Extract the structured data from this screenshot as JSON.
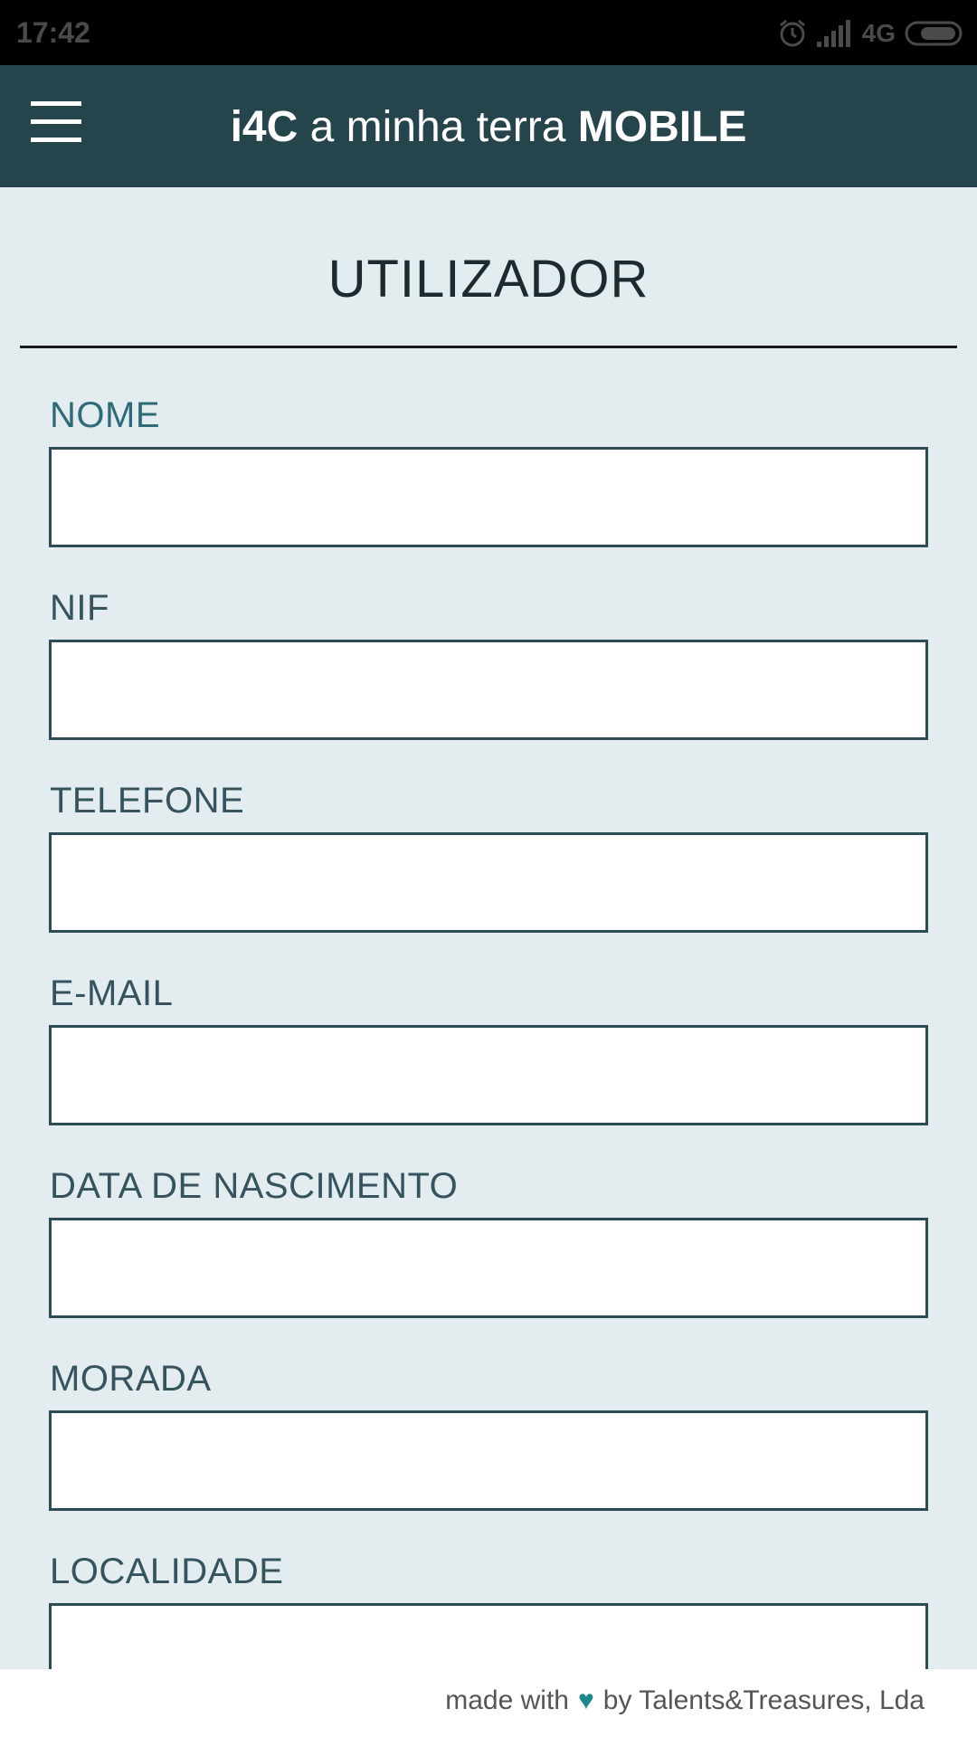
{
  "status_bar": {
    "time": "17:42",
    "network": "4G",
    "icons": [
      "alarm-icon",
      "signal-icon",
      "battery-icon"
    ]
  },
  "app_bar": {
    "title_brand": "i4C",
    "title_middle": " a minha terra ",
    "title_suffix": "MOBILE",
    "menu_icon": "hamburger-menu-icon"
  },
  "page": {
    "heading": "UTILIZADOR"
  },
  "form": {
    "fields": [
      {
        "label": "NOME",
        "value": ""
      },
      {
        "label": "NIF",
        "value": ""
      },
      {
        "label": "TELEFONE",
        "value": ""
      },
      {
        "label": "E-MAIL",
        "value": ""
      },
      {
        "label": "DATA DE NASCIMENTO",
        "value": ""
      },
      {
        "label": "MORADA",
        "value": ""
      },
      {
        "label": "LOCALIDADE",
        "value": ""
      }
    ]
  },
  "footer": {
    "prefix": "made with",
    "heart_icon": "heart-icon",
    "suffix": "by Talents&Treasures, Lda"
  },
  "colors": {
    "app_bar": "#25444c",
    "background": "#e3edf0",
    "label": "#2e6a78",
    "input_border": "#2b4c55",
    "heart": "#1a8a8a"
  }
}
